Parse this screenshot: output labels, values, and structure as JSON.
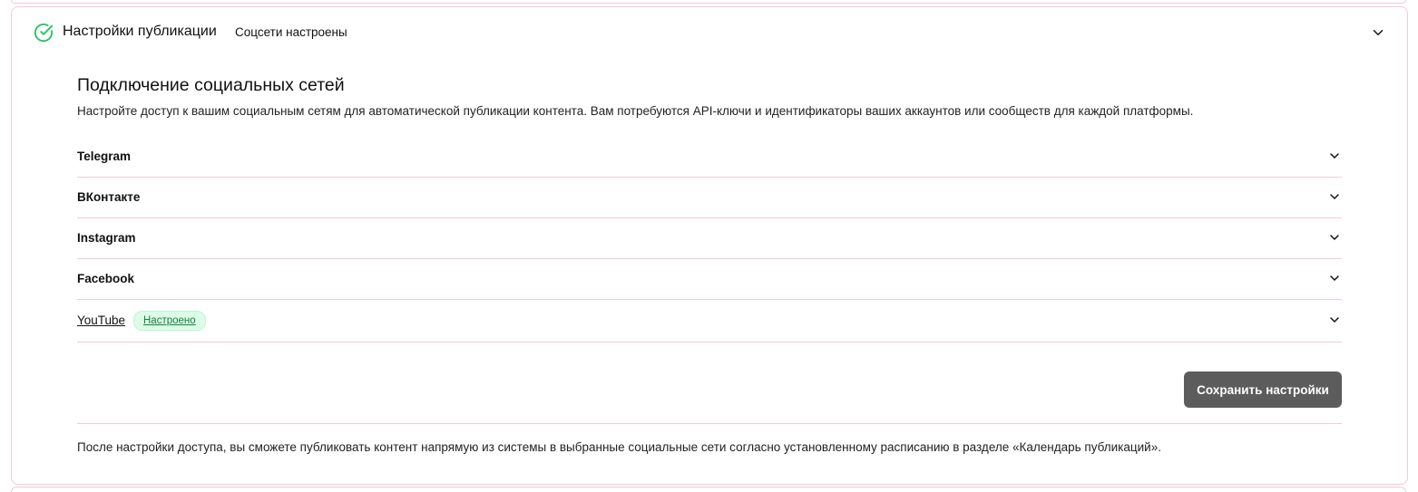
{
  "header": {
    "title": "Настройки публикации",
    "status": "Соцсети настроены",
    "icon": "check-circle-icon",
    "accent_color": "#22c55e"
  },
  "section": {
    "title": "Подключение социальных сетей",
    "description": "Настройте доступ к вашим социальным сетям для автоматической публикации контента. Вам потребуются API-ключи и идентификаторы ваших аккаунтов или сообществ для каждой платформы."
  },
  "networks": [
    {
      "label": "Telegram",
      "badge": ""
    },
    {
      "label": "ВКонтакте",
      "badge": ""
    },
    {
      "label": "Instagram",
      "badge": ""
    },
    {
      "label": "Facebook",
      "badge": ""
    },
    {
      "label": "YouTube",
      "badge": "Настроено"
    }
  ],
  "actions": {
    "save_label": "Сохранить настройки"
  },
  "footer": {
    "note": "После настройки доступа, вы сможете публиковать контент напрямую из системы в выбранные социальные сети согласно установленному расписанию в разделе «Календарь публикаций»."
  },
  "colors": {
    "border": "#f5c9d6",
    "badge_bg": "#dcfce7",
    "badge_text": "#15803d",
    "button_bg": "#5c5c5c"
  }
}
